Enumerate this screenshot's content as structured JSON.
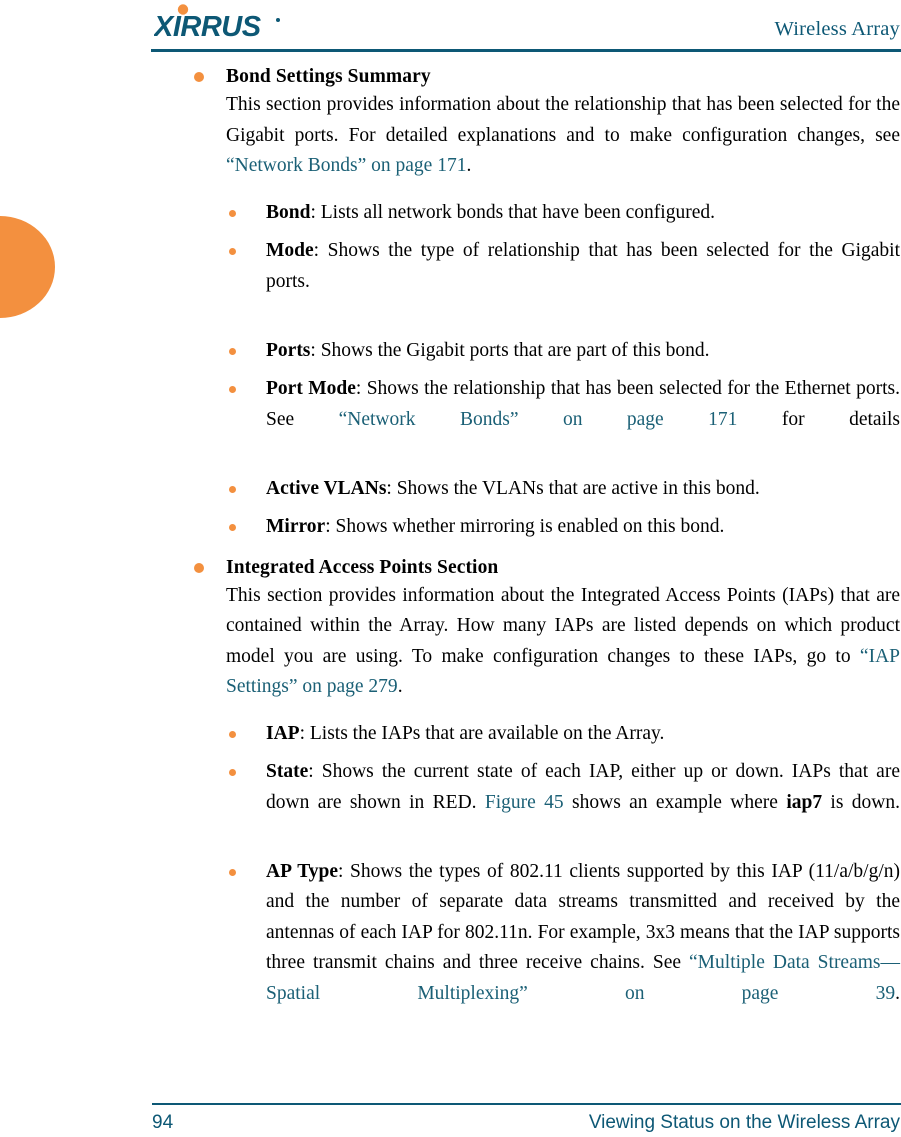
{
  "header": {
    "logo_text": "XIRRUS",
    "logo_colors": {
      "mark": "#0d5875",
      "dot": "#f3903f"
    },
    "title": "Wireless Array",
    "rule_color": "#0d5875"
  },
  "theme": {
    "bullet_orange": "#f3903f",
    "link_teal": "#1b6076",
    "accent_teal": "#0d5875",
    "body_black": "#000000",
    "page_background": "#ffffff"
  },
  "left_tab": {
    "name": "chapter-thumb-tab",
    "color": "#f3903f"
  },
  "sections": [
    {
      "heading": "Bond Settings Summary",
      "paragraph": {
        "pre": "This section provides information about the relationship that has been selected for the Gigabit ports. For detailed explanations and to make configuration changes, see ",
        "link": "“Network Bonds” on page 171",
        "post": "."
      },
      "bullets": [
        {
          "term": "Bond",
          "rest": ": Lists all network bonds that have been configured.",
          "justify": false
        },
        {
          "term": "Mode",
          "rest": ": Shows the type of relationship that has been selected for the Gigabit ports.",
          "justify": true
        },
        {
          "term": "Ports",
          "rest": ": Shows the Gigabit ports that are part of this bond.",
          "justify": false
        },
        {
          "term": "Port Mode",
          "rest_pre": ": Shows the relationship that has been selected for the Ethernet ports. See ",
          "link": "“Network Bonds” on page 171",
          "rest_post": " for details",
          "justify": true
        },
        {
          "term": "Active VLANs",
          "rest": ": Shows the VLANs that are active in this bond.",
          "justify": false
        },
        {
          "term": "Mirror",
          "rest": ": Shows whether mirroring is enabled on this bond.",
          "justify": false
        }
      ]
    },
    {
      "heading": "Integrated Access Points Section",
      "paragraph": {
        "pre": "This section provides information about the Integrated Access Points (IAPs) that are contained within the Array. How many IAPs are listed depends on which product model you are using. To make configuration changes to these IAPs, go to ",
        "link": "“IAP Settings” on page 279",
        "post": "."
      },
      "bullets": [
        {
          "term": "IAP",
          "rest": ": Lists the IAPs that are available on the Array.",
          "justify": false
        },
        {
          "term": "State",
          "rest_pre": ": Shows the current state of each IAP, either up or down. IAPs that are down are shown in RED. ",
          "link": "Figure 45",
          "rest_post": " shows an example where ",
          "bold_tail": "iap7",
          "tail": " is down.",
          "justify": true
        },
        {
          "term": "AP Type",
          "rest_pre": ": Shows the types of 802.11 clients supported by this IAP (11/a/b/g/n) and the number of separate data streams transmitted and received by the antennas of each IAP for 802.11n. For example, 3x3 means that the IAP supports three transmit chains and three receive chains. See ",
          "link": "“Multiple Data Streams—Spatial Multiplexing” on page 39",
          "rest_post": ".",
          "justify": true
        }
      ]
    }
  ],
  "footer": {
    "page_number": "94",
    "title": "Viewing Status on the Wireless Array"
  }
}
